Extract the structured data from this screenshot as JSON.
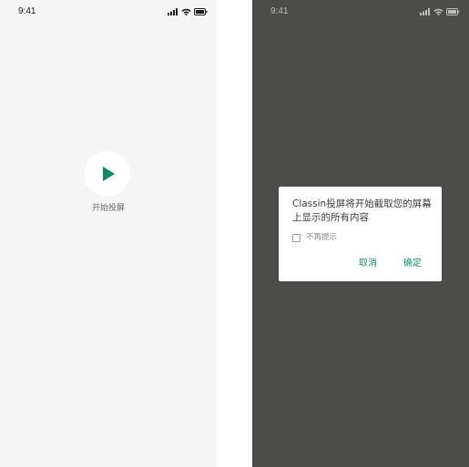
{
  "colors": {
    "accent": "#0f8a5f",
    "left_background": "#f5f5f5",
    "overlay_background": "#4c4c4a",
    "dialog_button": "#14936b"
  },
  "left_screen": {
    "status_bar": {
      "time": "9:41",
      "icons": [
        "cellular-signal-icon",
        "wifi-icon",
        "battery-icon"
      ]
    },
    "play_button": {
      "icon": "play-icon",
      "label": "开始投屏"
    }
  },
  "right_screen": {
    "status_bar": {
      "time": "9:41",
      "icons": [
        "cellular-signal-icon",
        "wifi-icon",
        "battery-icon"
      ]
    },
    "dialog": {
      "message_line1": "Classin投屏将开始截取您的屏幕",
      "message_line2": "上显示的所有内容",
      "checkbox_label": "不再提示",
      "checkbox_checked": false,
      "cancel_label": "取消",
      "confirm_label": "确定"
    }
  }
}
